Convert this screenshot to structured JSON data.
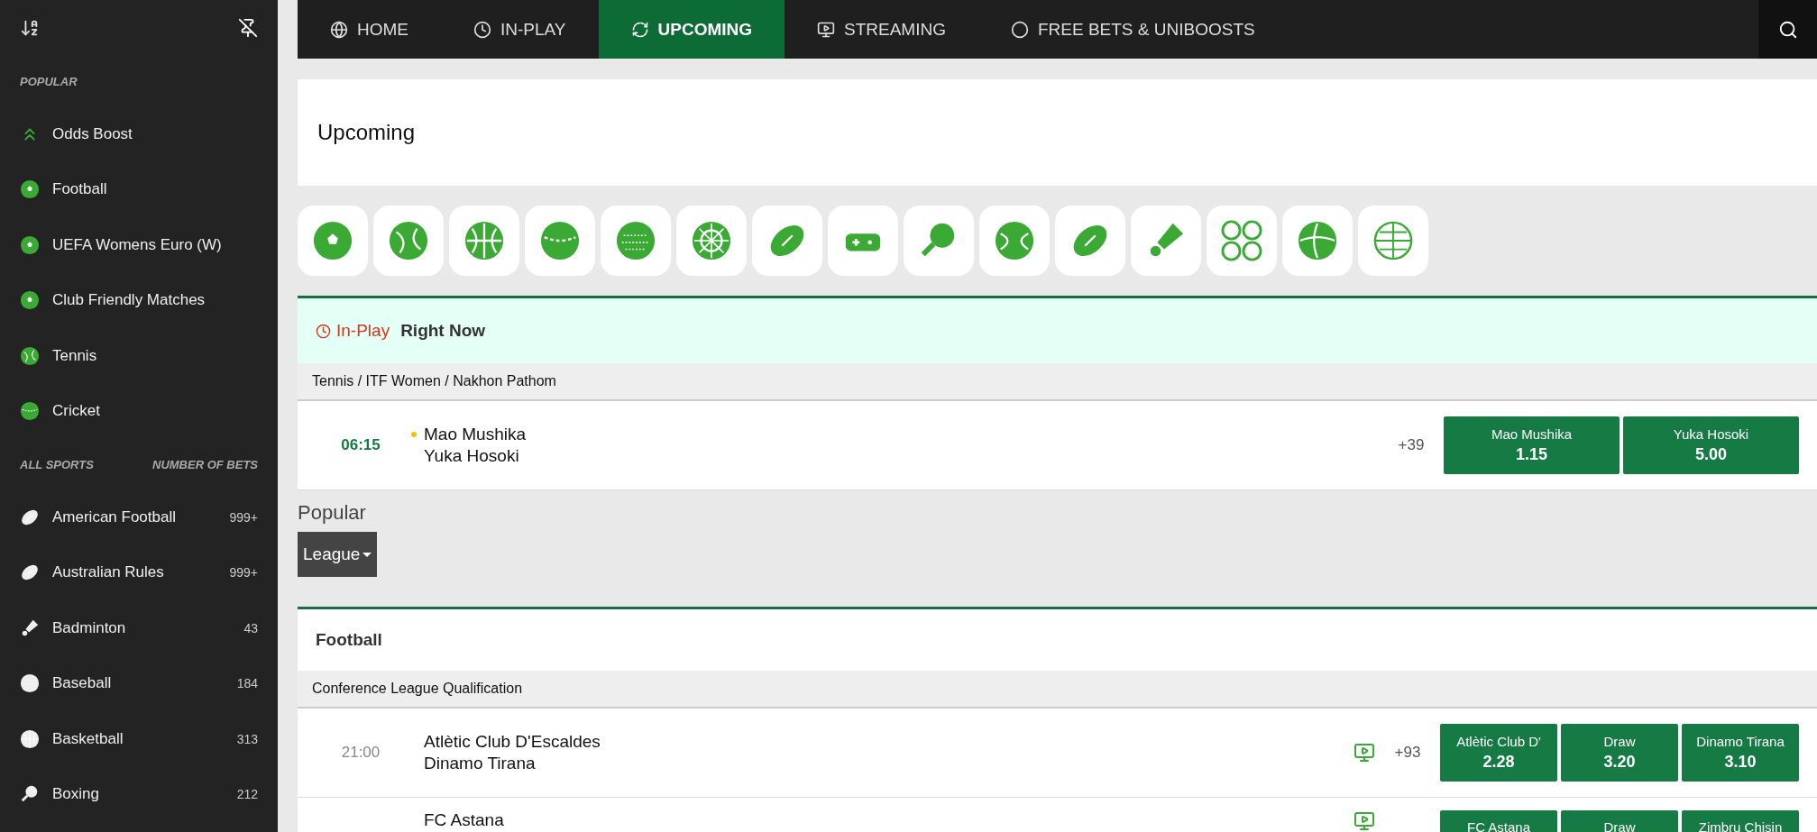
{
  "sidebar": {
    "popular_label": "POPULAR",
    "popular": [
      {
        "label": "Odds Boost"
      },
      {
        "label": "Football"
      },
      {
        "label": "UEFA Womens Euro (W)"
      },
      {
        "label": "Club Friendly Matches"
      },
      {
        "label": "Tennis"
      },
      {
        "label": "Cricket"
      }
    ],
    "all_sports_label": "ALL SPORTS",
    "count_label": "NUMBER OF BETS",
    "sports": [
      {
        "label": "American Football",
        "count": "999+"
      },
      {
        "label": "Australian Rules",
        "count": "999+"
      },
      {
        "label": "Badminton",
        "count": "43"
      },
      {
        "label": "Baseball",
        "count": "184"
      },
      {
        "label": "Basketball",
        "count": "313"
      },
      {
        "label": "Boxing",
        "count": "212"
      }
    ]
  },
  "nav": {
    "tabs": [
      {
        "label": "HOME",
        "selected": false
      },
      {
        "label": "IN-PLAY",
        "selected": false
      },
      {
        "label": "UPCOMING",
        "selected": true
      },
      {
        "label": "STREAMING",
        "selected": false
      },
      {
        "label": "FREE BETS & UNIBOOSTS",
        "selected": false
      }
    ]
  },
  "page_title": "Upcoming",
  "in_play": {
    "label": "In-Play",
    "title": "Right Now",
    "breadcrumb": "Tennis / ITF Women / Nakhon Pathom",
    "events": [
      {
        "time": "06:15",
        "live": true,
        "home": "Mao Mushika",
        "away": "Yuka Hosoki",
        "streaming": false,
        "markets": "+39",
        "odds": [
          {
            "label": "Mao Mushika",
            "price": "1.15"
          },
          {
            "label": "Yuka Hosoki",
            "price": "5.00"
          }
        ]
      }
    ]
  },
  "popular": {
    "title": "Popular",
    "filter": "League"
  },
  "football": {
    "title": "Football",
    "league": "Conference League Qualification",
    "events": [
      {
        "time": "21:00",
        "live": false,
        "home": "Atlètic Club D'Escaldes",
        "away": "Dinamo Tirana",
        "streaming": true,
        "markets": "+93",
        "odds": [
          {
            "label": "Atlètic Club D'",
            "price": "2.28"
          },
          {
            "label": "Draw",
            "price": "3.20"
          },
          {
            "label": "Dinamo Tirana",
            "price": "3.10"
          }
        ]
      },
      {
        "live": false,
        "home": "FC Astana",
        "streaming": true,
        "odds": [
          {
            "label": "FC Astana"
          },
          {
            "label": "Draw"
          },
          {
            "label": "Zimbru Chisin"
          }
        ]
      }
    ]
  }
}
